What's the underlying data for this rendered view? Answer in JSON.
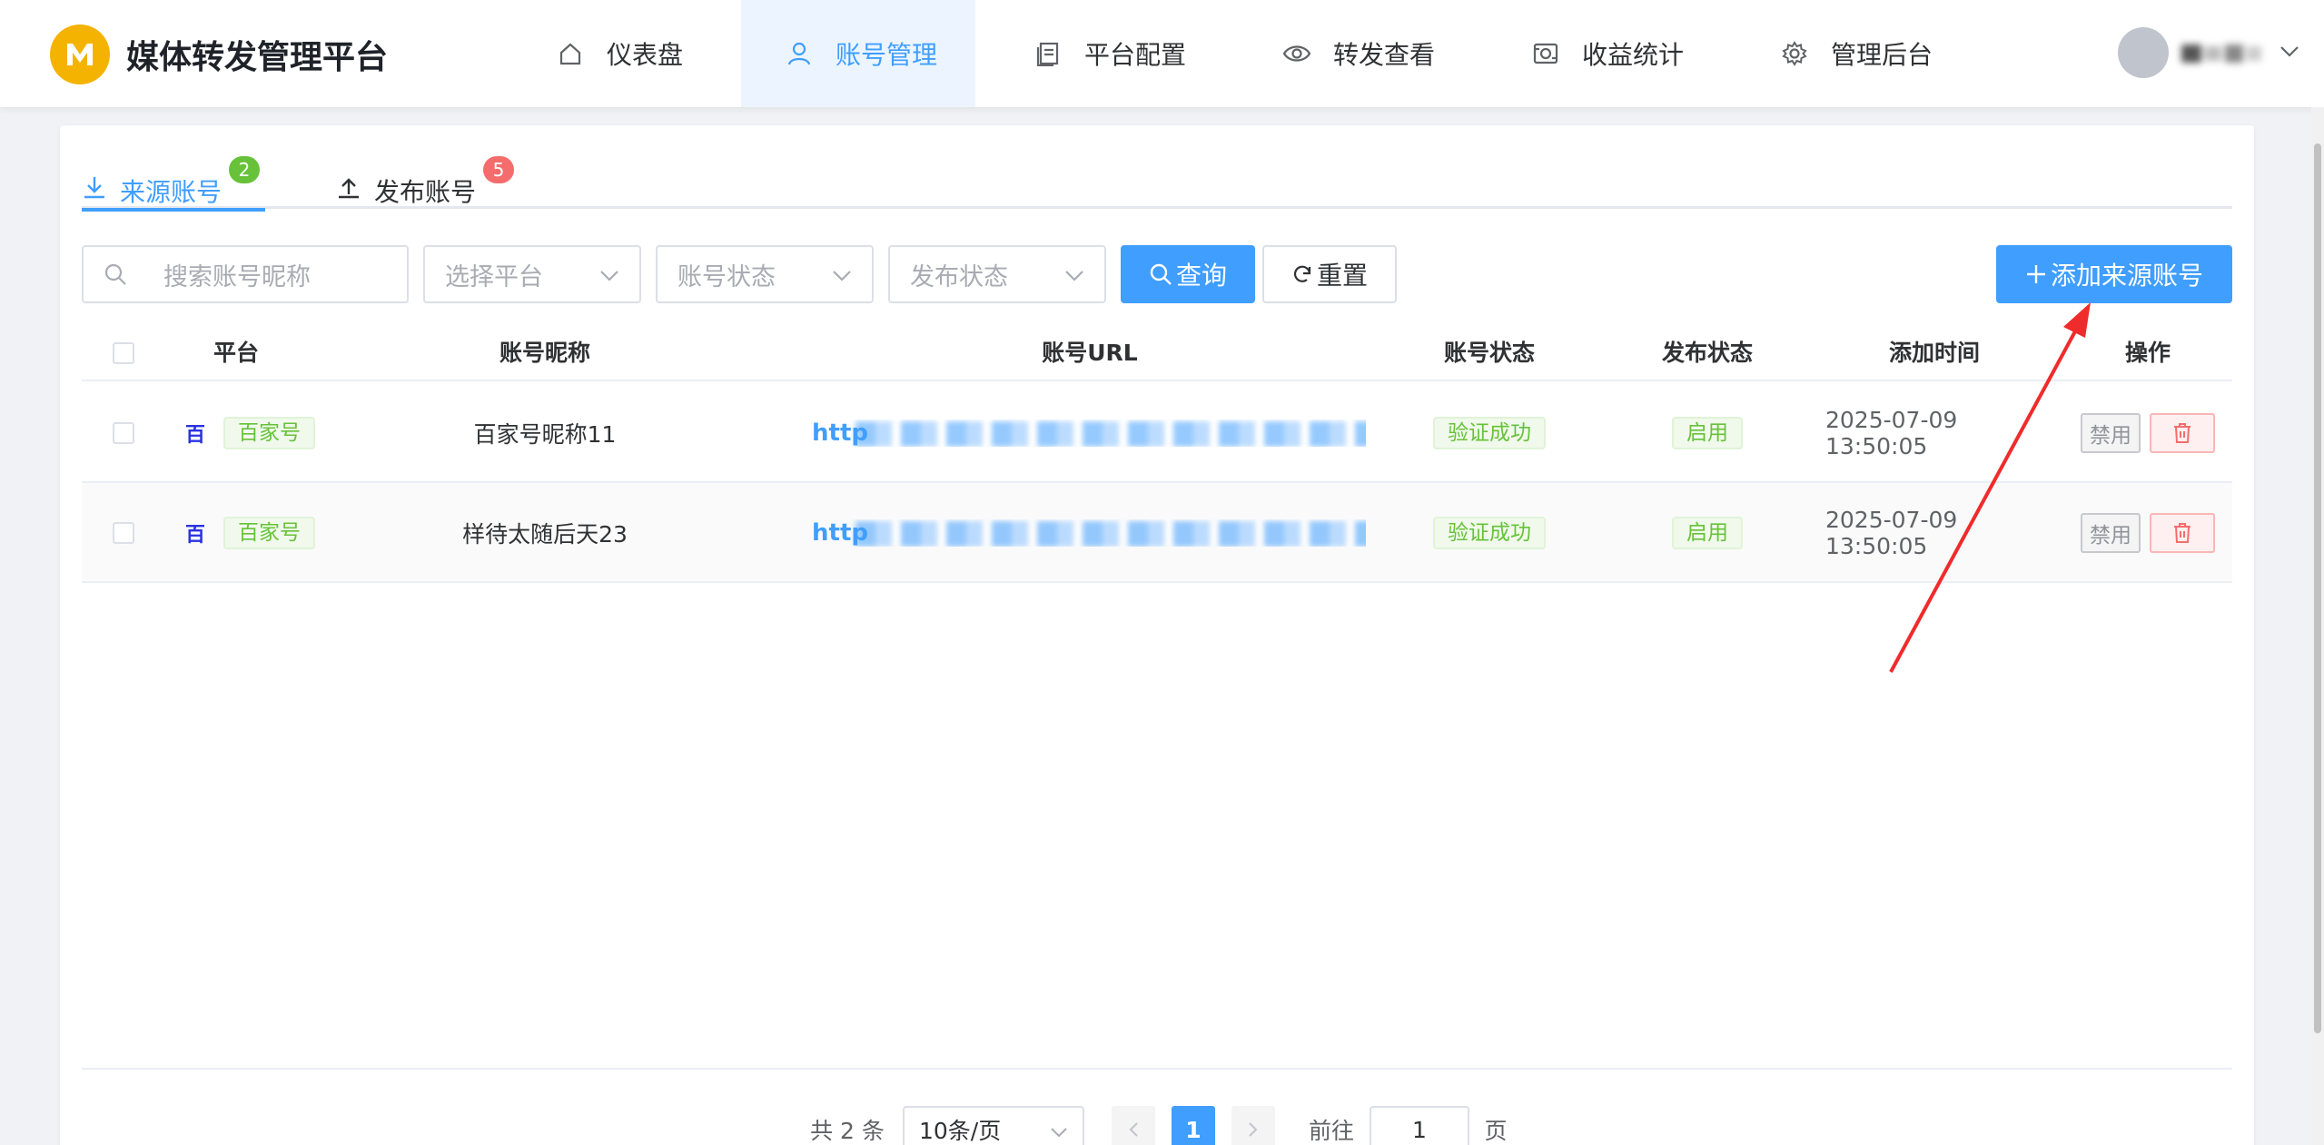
{
  "app": {
    "title": "媒体转发管理平台",
    "logo_letter": "M"
  },
  "nav": {
    "items": [
      {
        "label": "仪表盘",
        "icon": "home-icon"
      },
      {
        "label": "账号管理",
        "icon": "user-icon",
        "active": true
      },
      {
        "label": "平台配置",
        "icon": "document-icon"
      },
      {
        "label": "转发查看",
        "icon": "eye-icon"
      },
      {
        "label": "收益统计",
        "icon": "money-icon"
      },
      {
        "label": "管理后台",
        "icon": "gear-icon"
      }
    ]
  },
  "tabs": [
    {
      "label": "来源账号",
      "count": "2",
      "active": true
    },
    {
      "label": "发布账号",
      "count": "5"
    }
  ],
  "filters": {
    "search_placeholder": "搜索账号昵称",
    "platform_placeholder": "选择平台",
    "account_status_placeholder": "账号状态",
    "publish_status_placeholder": "发布状态",
    "query_label": "查询",
    "reset_label": "重置",
    "add_label": "添加来源账号"
  },
  "table": {
    "columns": [
      "平台",
      "账号昵称",
      "账号URL",
      "账号状态",
      "发布状态",
      "添加时间",
      "操作"
    ],
    "rows": [
      {
        "platform": "百家号",
        "platform_icon": "百",
        "nickname": "百家号昵称11",
        "url": "http",
        "account_status": "验证成功",
        "publish_status": "启用",
        "added": "2025-07-09 13:50:05",
        "disable_label": "禁用"
      },
      {
        "platform": "百家号",
        "platform_icon": "百",
        "nickname": "样待太随后天23",
        "url": "http",
        "account_status": "验证成功",
        "publish_status": "启用",
        "added": "2025-07-09 13:50:05",
        "disable_label": "禁用"
      }
    ]
  },
  "pagination": {
    "total_text": "共 2 条",
    "page_size": "10条/页",
    "current_page": "1",
    "goto_label": "前往",
    "goto_value": "1",
    "page_suffix": "页"
  },
  "colors": {
    "primary": "#409eff",
    "success": "#67c23a",
    "danger": "#f56c6c",
    "brand": "#f5b301",
    "annotation": "#f02b2b"
  }
}
